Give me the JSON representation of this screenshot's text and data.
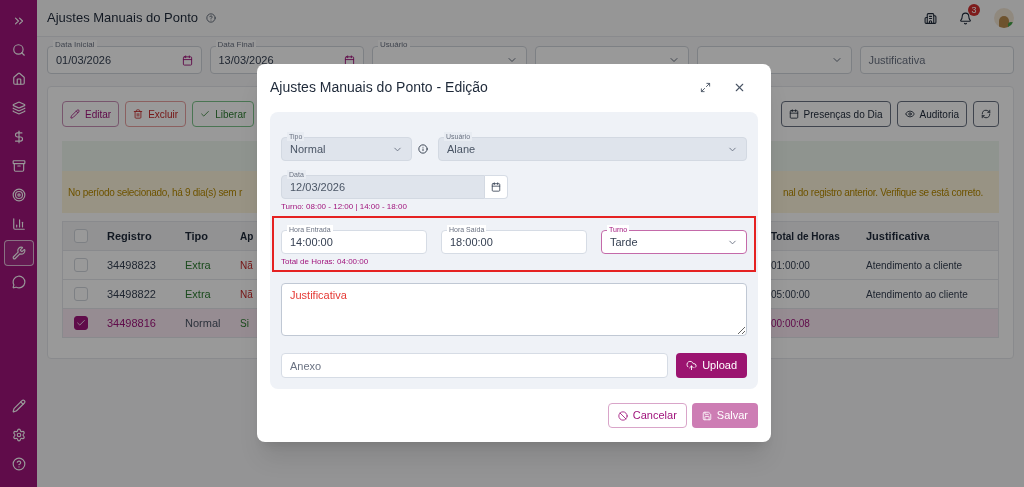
{
  "sidebar": {
    "items": [
      {
        "selected": false
      },
      {
        "selected": false
      },
      {
        "selected": false
      },
      {
        "selected": false
      },
      {
        "selected": false
      },
      {
        "selected": false
      },
      {
        "selected": false
      },
      {
        "selected": false
      },
      {
        "selected": true
      },
      {
        "selected": false
      }
    ]
  },
  "header": {
    "title": "Ajustes Manuais do Ponto",
    "notifications": "3"
  },
  "filters": [
    {
      "kind": "date",
      "label": "Data Inicial",
      "value": "01/03/2026"
    },
    {
      "kind": "date",
      "label": "Data Final",
      "value": "13/03/2026"
    },
    {
      "kind": "select",
      "label": "Usuário"
    },
    {
      "kind": "select"
    },
    {
      "kind": "select"
    },
    {
      "kind": "text",
      "placeholder": "Justificativa"
    }
  ],
  "toolbar": {
    "left": [
      {
        "kind": "edit",
        "label": "Editar"
      },
      {
        "kind": "delete",
        "label": "Excluir"
      },
      {
        "kind": "approve",
        "label": "Liberar"
      }
    ],
    "right": [
      {
        "kind": "calendar",
        "label": "Presenças do Dia"
      },
      {
        "kind": "audit",
        "label": "Auditoria"
      },
      {
        "kind": "refresh"
      }
    ]
  },
  "warning": {
    "left": "No período selecionado, há 9 dia(s) sem r",
    "right": "nal do registro anterior. Verifique se está correto."
  },
  "table": {
    "all_selected": false,
    "columns": [
      "Registro",
      "Tipo",
      "Ap",
      "Total de Horas",
      "Justificativa"
    ],
    "rows": [
      {
        "selected": false,
        "registro": "34498823",
        "tipo": "Extra",
        "extra": true,
        "ap": "Nã",
        "approved": false,
        "total": "01:00:00",
        "justificativa": "Atendimento a cliente"
      },
      {
        "selected": false,
        "registro": "34498822",
        "tipo": "Extra",
        "extra": true,
        "ap": "Nã",
        "approved": false,
        "total": "05:00:00",
        "justificativa": "Atendimento ao cliente"
      },
      {
        "selected": true,
        "registro": "34498816",
        "tipo": "Normal",
        "extra": false,
        "ap": "Si",
        "approved": true,
        "total": "00:00:08"
      }
    ]
  },
  "modal": {
    "title": "Ajustes Manuais do Ponto - Edição",
    "tipo": {
      "label": "Tipo",
      "value": "Normal",
      "disabled": true
    },
    "usuario": {
      "label": "Usuário",
      "value": "Alane",
      "disabled": true
    },
    "data": {
      "label": "Data",
      "value": "12/03/2026",
      "disabled": true,
      "hint": "Turno: 08:00 - 12:00 | 14:00 - 18:00"
    },
    "hora_entrada": {
      "label": "Hora Entrada",
      "value": "14:00:00"
    },
    "hora_saida": {
      "label": "Hora Saída",
      "value": "18:00:00"
    },
    "turno": {
      "label": "Turno",
      "value": "Tarde"
    },
    "total": "Total de Horas: 04:00:00",
    "justificativa": {
      "placeholder": "Justificativa",
      "invalid": true
    },
    "anexo": {
      "placeholder": "Anexo"
    },
    "upload": "Upload",
    "cancel": "Cancelar",
    "save": {
      "label": "Salvar",
      "disabled": true
    }
  }
}
